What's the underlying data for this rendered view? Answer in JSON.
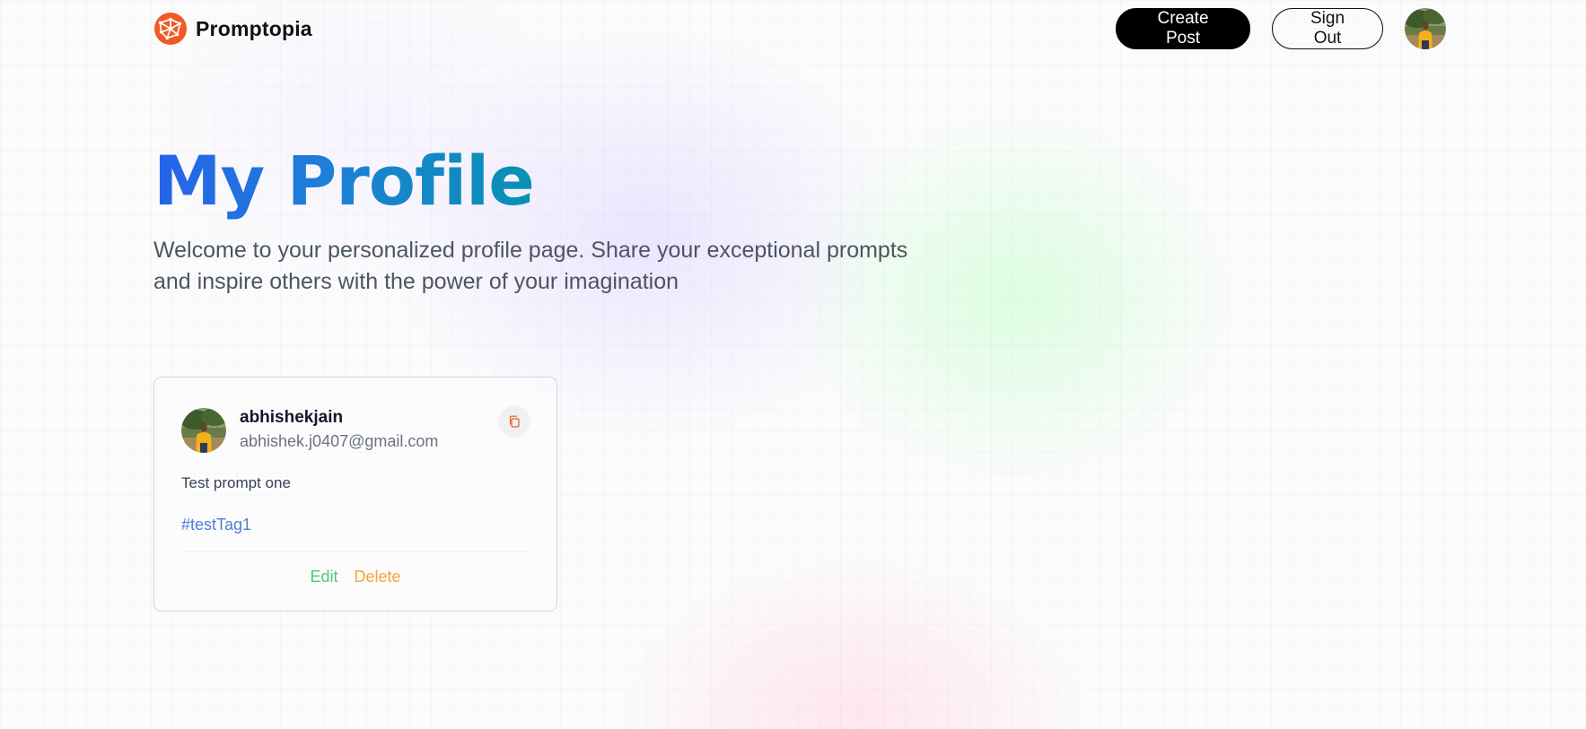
{
  "nav": {
    "brand_name": "Promptopia",
    "brand_color": "#f05a24",
    "logo_icon": "globe-network-icon",
    "create_post_label": "Create Post",
    "sign_out_label": "Sign Out"
  },
  "hero": {
    "title": "My Profile",
    "description": "Welcome to your personalized profile page. Share your exceptional prompts and inspire others with the power of your imagination",
    "title_gradient": [
      "#2563eb",
      "#0891b2"
    ]
  },
  "prompts": [
    {
      "username": "abhishekjain",
      "email": "abhishek.j0407@gmail.com",
      "text": "Test prompt one",
      "tag": "#testTag1",
      "edit_label": "Edit",
      "delete_label": "Delete",
      "copy_icon": "copy-icon"
    }
  ],
  "colors": {
    "edit": "#4ec77a",
    "delete": "#f2a33a",
    "tag": "#4f7fd4",
    "copy_icon": "#f05a24"
  }
}
